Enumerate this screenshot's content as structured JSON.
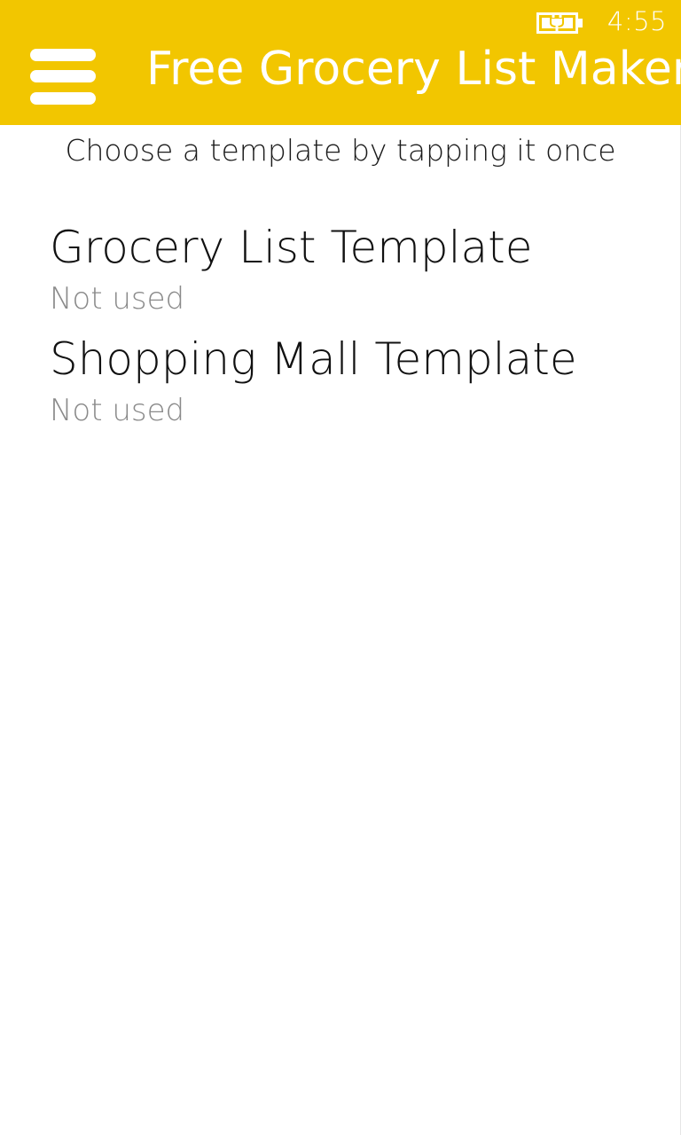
{
  "status_bar": {
    "time": "4:55",
    "battery_icon": "battery-charging-icon"
  },
  "header": {
    "title": "Free Grocery List Maker",
    "menu_icon": "hamburger-menu-icon"
  },
  "colors": {
    "accent": "#f2c600",
    "background": "#ffffff",
    "text_primary": "#111111",
    "text_secondary": "#8a8a8a"
  },
  "instruction": "Choose a template by tapping it once",
  "templates": [
    {
      "name": "Grocery List Template",
      "status": "Not used"
    },
    {
      "name": "Shopping Mall Template",
      "status": "Not used"
    }
  ]
}
